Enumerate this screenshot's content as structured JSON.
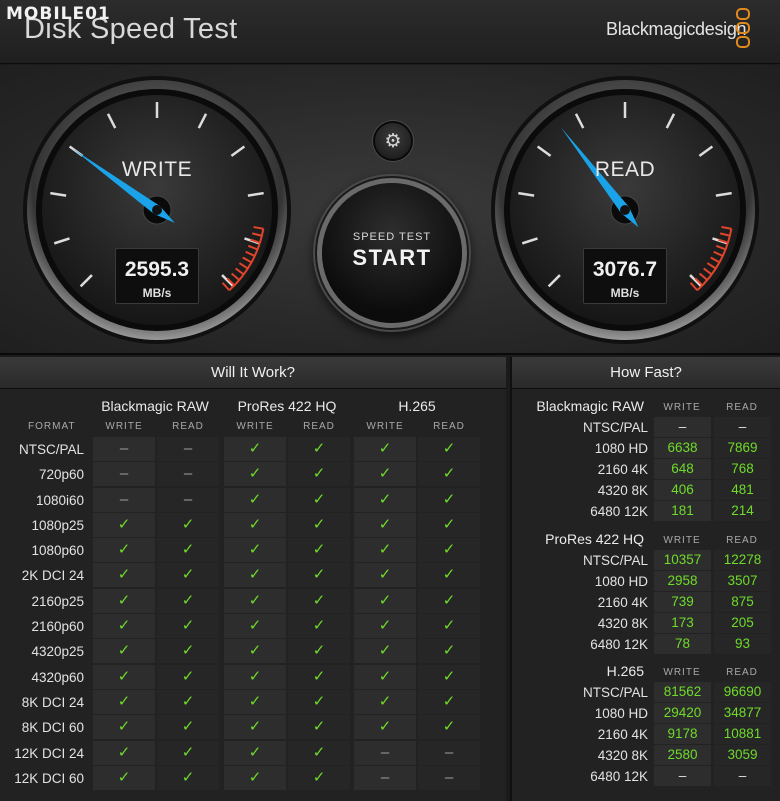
{
  "watermark": "MOBILE01",
  "app_title": "Disk Speed Test",
  "brand": "Blackmagicdesign",
  "colors": {
    "needle": "#1aa3e8",
    "check": "#6fdb2a",
    "redline": "#e0452b",
    "logo": "#e08a1e"
  },
  "gauges": {
    "write": {
      "label": "WRITE",
      "value": "2595.3",
      "unit": "MB/s",
      "level": 0.3
    },
    "read": {
      "label": "READ",
      "value": "3076.7",
      "unit": "MB/s",
      "level": 0.36
    }
  },
  "settings_icon": "gear-icon",
  "start": {
    "sub": "SPEED TEST",
    "main": "START"
  },
  "will_it_work": {
    "title": "Will It Work?",
    "format_header": "FORMAT",
    "codecs": [
      "Blackmagic RAW",
      "ProRes 422 HQ",
      "H.265"
    ],
    "subheaders": [
      "WRITE",
      "READ"
    ],
    "rows": [
      {
        "format": "NTSC/PAL",
        "cells": [
          "no",
          "no",
          "ok",
          "ok",
          "ok",
          "ok"
        ]
      },
      {
        "format": "720p60",
        "cells": [
          "no",
          "no",
          "ok",
          "ok",
          "ok",
          "ok"
        ]
      },
      {
        "format": "1080i60",
        "cells": [
          "no",
          "no",
          "ok",
          "ok",
          "ok",
          "ok"
        ]
      },
      {
        "format": "1080p25",
        "cells": [
          "ok",
          "ok",
          "ok",
          "ok",
          "ok",
          "ok"
        ]
      },
      {
        "format": "1080p60",
        "cells": [
          "ok",
          "ok",
          "ok",
          "ok",
          "ok",
          "ok"
        ]
      },
      {
        "format": "2K DCI 24",
        "cells": [
          "ok",
          "ok",
          "ok",
          "ok",
          "ok",
          "ok"
        ]
      },
      {
        "format": "2160p25",
        "cells": [
          "ok",
          "ok",
          "ok",
          "ok",
          "ok",
          "ok"
        ]
      },
      {
        "format": "2160p60",
        "cells": [
          "ok",
          "ok",
          "ok",
          "ok",
          "ok",
          "ok"
        ]
      },
      {
        "format": "4320p25",
        "cells": [
          "ok",
          "ok",
          "ok",
          "ok",
          "ok",
          "ok"
        ]
      },
      {
        "format": "4320p60",
        "cells": [
          "ok",
          "ok",
          "ok",
          "ok",
          "ok",
          "ok"
        ]
      },
      {
        "format": "8K DCI 24",
        "cells": [
          "ok",
          "ok",
          "ok",
          "ok",
          "ok",
          "ok"
        ]
      },
      {
        "format": "8K DCI 60",
        "cells": [
          "ok",
          "ok",
          "ok",
          "ok",
          "ok",
          "ok"
        ]
      },
      {
        "format": "12K DCI 24",
        "cells": [
          "ok",
          "ok",
          "ok",
          "ok",
          "no",
          "no"
        ]
      },
      {
        "format": "12K DCI 60",
        "cells": [
          "ok",
          "ok",
          "ok",
          "ok",
          "no",
          "no"
        ]
      }
    ]
  },
  "how_fast": {
    "title": "How Fast?",
    "write_header": "WRITE",
    "read_header": "READ",
    "groups": [
      {
        "name": "Blackmagic RAW",
        "rows": [
          {
            "format": "NTSC/PAL",
            "write": "",
            "read": ""
          },
          {
            "format": "1080 HD",
            "write": "6638",
            "read": "7869"
          },
          {
            "format": "2160 4K",
            "write": "648",
            "read": "768"
          },
          {
            "format": "4320 8K",
            "write": "406",
            "read": "481"
          },
          {
            "format": "6480 12K",
            "write": "181",
            "read": "214"
          }
        ]
      },
      {
        "name": "ProRes 422 HQ",
        "rows": [
          {
            "format": "NTSC/PAL",
            "write": "10357",
            "read": "12278"
          },
          {
            "format": "1080 HD",
            "write": "2958",
            "read": "3507"
          },
          {
            "format": "2160 4K",
            "write": "739",
            "read": "875"
          },
          {
            "format": "4320 8K",
            "write": "173",
            "read": "205"
          },
          {
            "format": "6480 12K",
            "write": "78",
            "read": "93"
          }
        ]
      },
      {
        "name": "H.265",
        "rows": [
          {
            "format": "NTSC/PAL",
            "write": "81562",
            "read": "96690"
          },
          {
            "format": "1080 HD",
            "write": "29420",
            "read": "34877"
          },
          {
            "format": "2160 4K",
            "write": "9178",
            "read": "10881"
          },
          {
            "format": "4320 8K",
            "write": "2580",
            "read": "3059"
          },
          {
            "format": "6480 12K",
            "write": "–",
            "read": "–"
          }
        ]
      }
    ]
  }
}
